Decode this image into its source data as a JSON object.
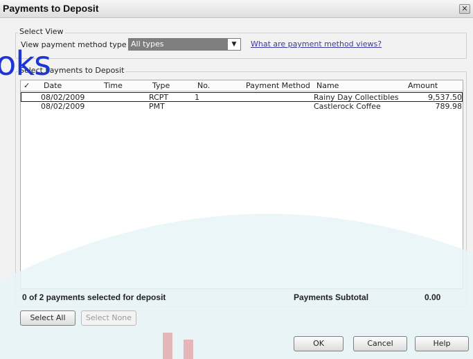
{
  "window": {
    "title": "Payments to Deposit",
    "close_glyph": "✕"
  },
  "select_view": {
    "group_label": "Select View",
    "filter_label": "View payment method type",
    "filter_value": "All types",
    "help_link": "What are payment method views?"
  },
  "payments": {
    "group_label": "Select Payments to Deposit",
    "columns": {
      "check": "✓",
      "date": "Date",
      "time": "Time",
      "type": "Type",
      "no": "No.",
      "method": "Payment Method",
      "name": "Name",
      "amount": "Amount"
    },
    "rows": [
      {
        "date": "08/02/2009",
        "time": "",
        "type": "RCPT",
        "no": "1",
        "method": "",
        "name": "Rainy Day Collectibles",
        "amount": "9,537.50"
      },
      {
        "date": "08/02/2009",
        "time": "",
        "type": "PMT",
        "no": "",
        "method": "",
        "name": "Castlerock Coffee",
        "amount": "789.98"
      }
    ]
  },
  "summary": {
    "selected_text": "0 of 2 payments selected for deposit",
    "subtotal_label": "Payments Subtotal",
    "subtotal_value": "0.00"
  },
  "buttons": {
    "select_all": "Select All",
    "select_none": "Select None",
    "ok": "OK",
    "cancel": "Cancel",
    "help": "Help"
  },
  "watermark": {
    "text": "oks",
    "color": "#1e35d4",
    "arc_color": "#e6f4f7"
  }
}
